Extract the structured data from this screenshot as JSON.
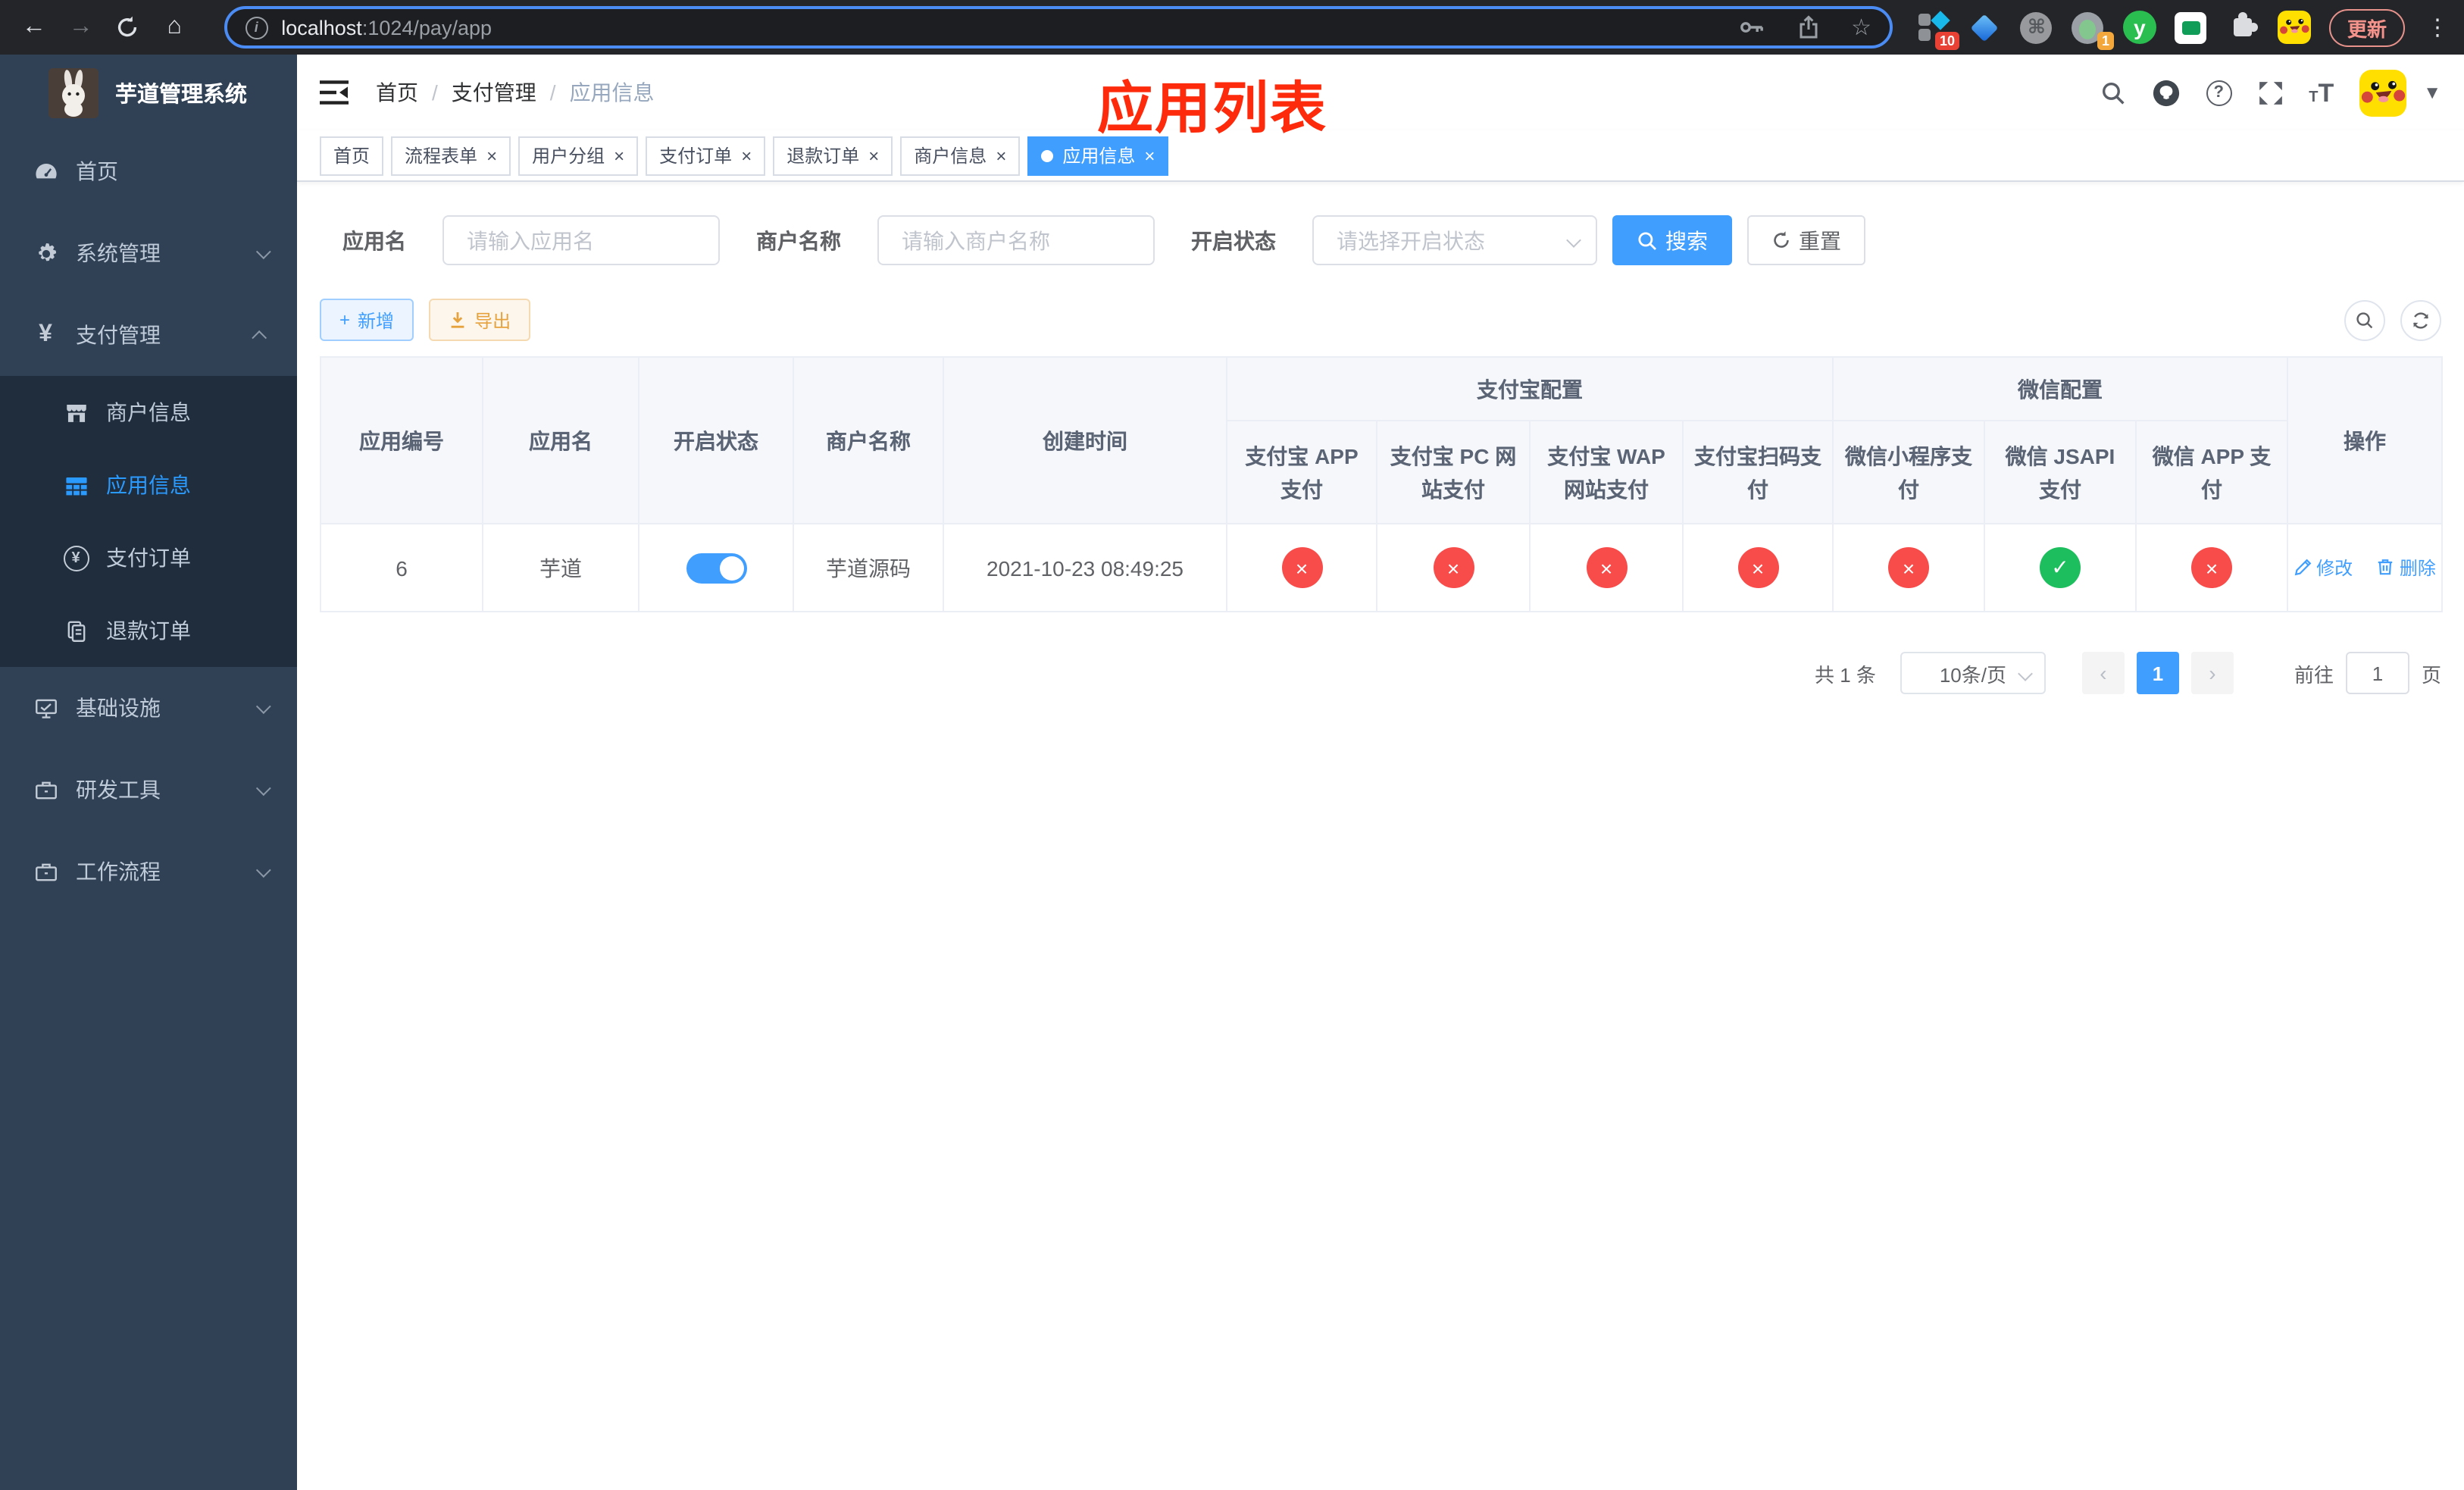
{
  "browser": {
    "url_host": "localhost",
    "url_rest": ":1024/pay/app",
    "update_label": "更新",
    "badge_ten": "10",
    "badge_one": "1",
    "ext_letter": "y"
  },
  "sidebar": {
    "title": "芋道管理系统",
    "home": "首页",
    "system": "系统管理",
    "payment": "支付管理",
    "merchant_info": "商户信息",
    "app_info": "应用信息",
    "pay_order": "支付订单",
    "refund_order": "退款订单",
    "infra": "基础设施",
    "dev_tools": "研发工具",
    "workflow": "工作流程"
  },
  "navbar": {
    "breadcrumb": [
      "首页",
      "支付管理",
      "应用信息"
    ],
    "overlay_title": "应用列表"
  },
  "tabs": [
    {
      "label": "首页",
      "closable": false,
      "active": false
    },
    {
      "label": "流程表单",
      "closable": true,
      "active": false
    },
    {
      "label": "用户分组",
      "closable": true,
      "active": false
    },
    {
      "label": "支付订单",
      "closable": true,
      "active": false
    },
    {
      "label": "退款订单",
      "closable": true,
      "active": false
    },
    {
      "label": "商户信息",
      "closable": true,
      "active": false
    },
    {
      "label": "应用信息",
      "closable": true,
      "active": true
    }
  ],
  "filters": {
    "app_name_label": "应用名",
    "app_name_placeholder": "请输入应用名",
    "merchant_label": "商户名称",
    "merchant_placeholder": "请输入商户名称",
    "status_label": "开启状态",
    "status_placeholder": "请选择开启状态",
    "search_label": "搜索",
    "reset_label": "重置"
  },
  "toolbar": {
    "add_label": "新增",
    "export_label": "导出"
  },
  "table": {
    "simple_columns": [
      "应用编号",
      "应用名",
      "开启状态",
      "商户名称",
      "创建时间"
    ],
    "alipay_group": "支付宝配置",
    "alipay_columns": [
      "支付宝 APP 支付",
      "支付宝 PC 网站支付",
      "支付宝 WAP 网站支付",
      "支付宝扫码支付"
    ],
    "wechat_group": "微信配置",
    "wechat_columns": [
      "微信小程序支付",
      "微信 JSAPI 支付",
      "微信 APP 支付"
    ],
    "actions_column": "操作",
    "glyph_fail": "×",
    "glyph_ok": "✓",
    "row": {
      "id": "6",
      "name": "芋道",
      "enabled": true,
      "merchant": "芋道源码",
      "created": "2021-10-23 08:49:25",
      "statuses": [
        "fail",
        "fail",
        "fail",
        "fail",
        "fail",
        "ok",
        "fail"
      ],
      "edit": "修改",
      "delete": "删除"
    }
  },
  "pagination": {
    "total": "共 1 条",
    "page_size": "10条/页",
    "page": "1",
    "goto_label": "前往",
    "goto_value": "1",
    "unit": "页"
  },
  "colors": {
    "accent": "#409eff",
    "success": "#1dbe5d",
    "danger": "#f84c4b",
    "sidebar_bg": "#304156",
    "submenu_bg": "#1f2d3d",
    "title_red": "#fd2b0b"
  }
}
